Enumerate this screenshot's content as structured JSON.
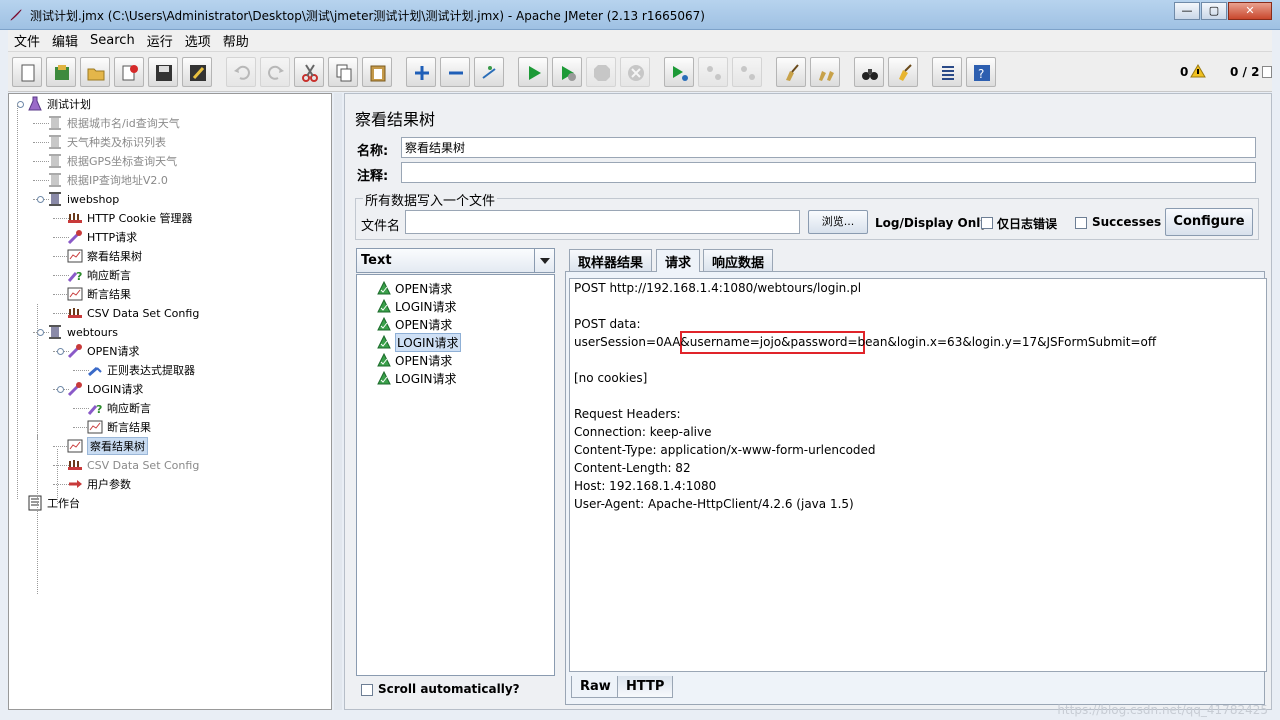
{
  "window": {
    "title": "测试计划.jmx (C:\\Users\\Administrator\\Desktop\\测试\\jmeter测试计划\\测试计划.jmx) - Apache JMeter (2.13 r1665067)",
    "minimize": "—",
    "maximize": "▢",
    "close": "✕"
  },
  "menu": [
    "文件",
    "编辑",
    "Search",
    "运行",
    "选项",
    "帮助"
  ],
  "toolbar": {
    "error_count": "0",
    "threads": "0 / 2"
  },
  "tree": {
    "items": [
      {
        "label": "测试计划",
        "dim": false,
        "sel": false
      },
      {
        "label": "根据城市名/id查询天气",
        "dim": true,
        "sel": false
      },
      {
        "label": "天气种类及标识列表",
        "dim": true,
        "sel": false
      },
      {
        "label": "根据GPS坐标查询天气",
        "dim": true,
        "sel": false
      },
      {
        "label": "根据IP查询地址V2.0",
        "dim": true,
        "sel": false
      },
      {
        "label": "iwebshop",
        "dim": false,
        "sel": false
      },
      {
        "label": "HTTP Cookie 管理器",
        "dim": false,
        "sel": false
      },
      {
        "label": "HTTP请求",
        "dim": false,
        "sel": false
      },
      {
        "label": "察看结果树",
        "dim": false,
        "sel": false
      },
      {
        "label": "响应断言",
        "dim": false,
        "sel": false
      },
      {
        "label": "断言结果",
        "dim": false,
        "sel": false
      },
      {
        "label": "CSV Data Set Config",
        "dim": false,
        "sel": false
      },
      {
        "label": "webtours",
        "dim": false,
        "sel": false
      },
      {
        "label": "OPEN请求",
        "dim": false,
        "sel": false
      },
      {
        "label": "正则表达式提取器",
        "dim": false,
        "sel": false
      },
      {
        "label": "LOGIN请求",
        "dim": false,
        "sel": false
      },
      {
        "label": "响应断言",
        "dim": false,
        "sel": false
      },
      {
        "label": "断言结果",
        "dim": false,
        "sel": false
      },
      {
        "label": "察看结果树",
        "dim": false,
        "sel": true
      },
      {
        "label": "CSV Data Set Config",
        "dim": true,
        "sel": false
      },
      {
        "label": "用户参数",
        "dim": false,
        "sel": false
      },
      {
        "label": "工作台",
        "dim": false,
        "sel": false
      }
    ]
  },
  "panel": {
    "title": "察看结果树",
    "name_label": "名称:",
    "name_value": "察看结果树",
    "comment_label": "注释:",
    "comment_value": "",
    "group_title": "所有数据写入一个文件",
    "file_label": "文件名",
    "file_value": "",
    "browse": "浏览...",
    "log_display": "Log/Display Only:",
    "errors_only": "仅日志错误",
    "successes": "Successes",
    "configure": "Configure"
  },
  "results": {
    "renderer": "Text",
    "items": [
      "OPEN请求",
      "LOGIN请求",
      "OPEN请求",
      "LOGIN请求",
      "OPEN请求",
      "LOGIN请求"
    ],
    "selected_index": 3,
    "scroll_auto": "Scroll automatically?"
  },
  "tabs": [
    "取样器结果",
    "请求",
    "响应数据"
  ],
  "active_tab": 1,
  "request": {
    "lines": [
      "POST http://192.168.1.4:1080/webtours/login.pl",
      "",
      "POST data:",
      "userSession=0AA&username=jojo&password=bean&login.x=63&login.y=17&JSFormSubmit=off",
      "",
      "[no cookies]",
      "",
      "Request Headers:",
      "Connection: keep-alive",
      "Content-Type: application/x-www-form-urlencoded",
      "Content-Length: 82",
      "Host: 192.168.1.4:1080",
      "User-Agent: Apache-HttpClient/4.2.6 (java 1.5)"
    ]
  },
  "bottom_tabs": [
    "Raw",
    "HTTP"
  ],
  "watermark": "https://blog.csdn.net/qq_41782425",
  "colors": {
    "highlight": "#e0242a",
    "selection": "#c9dcf2"
  }
}
